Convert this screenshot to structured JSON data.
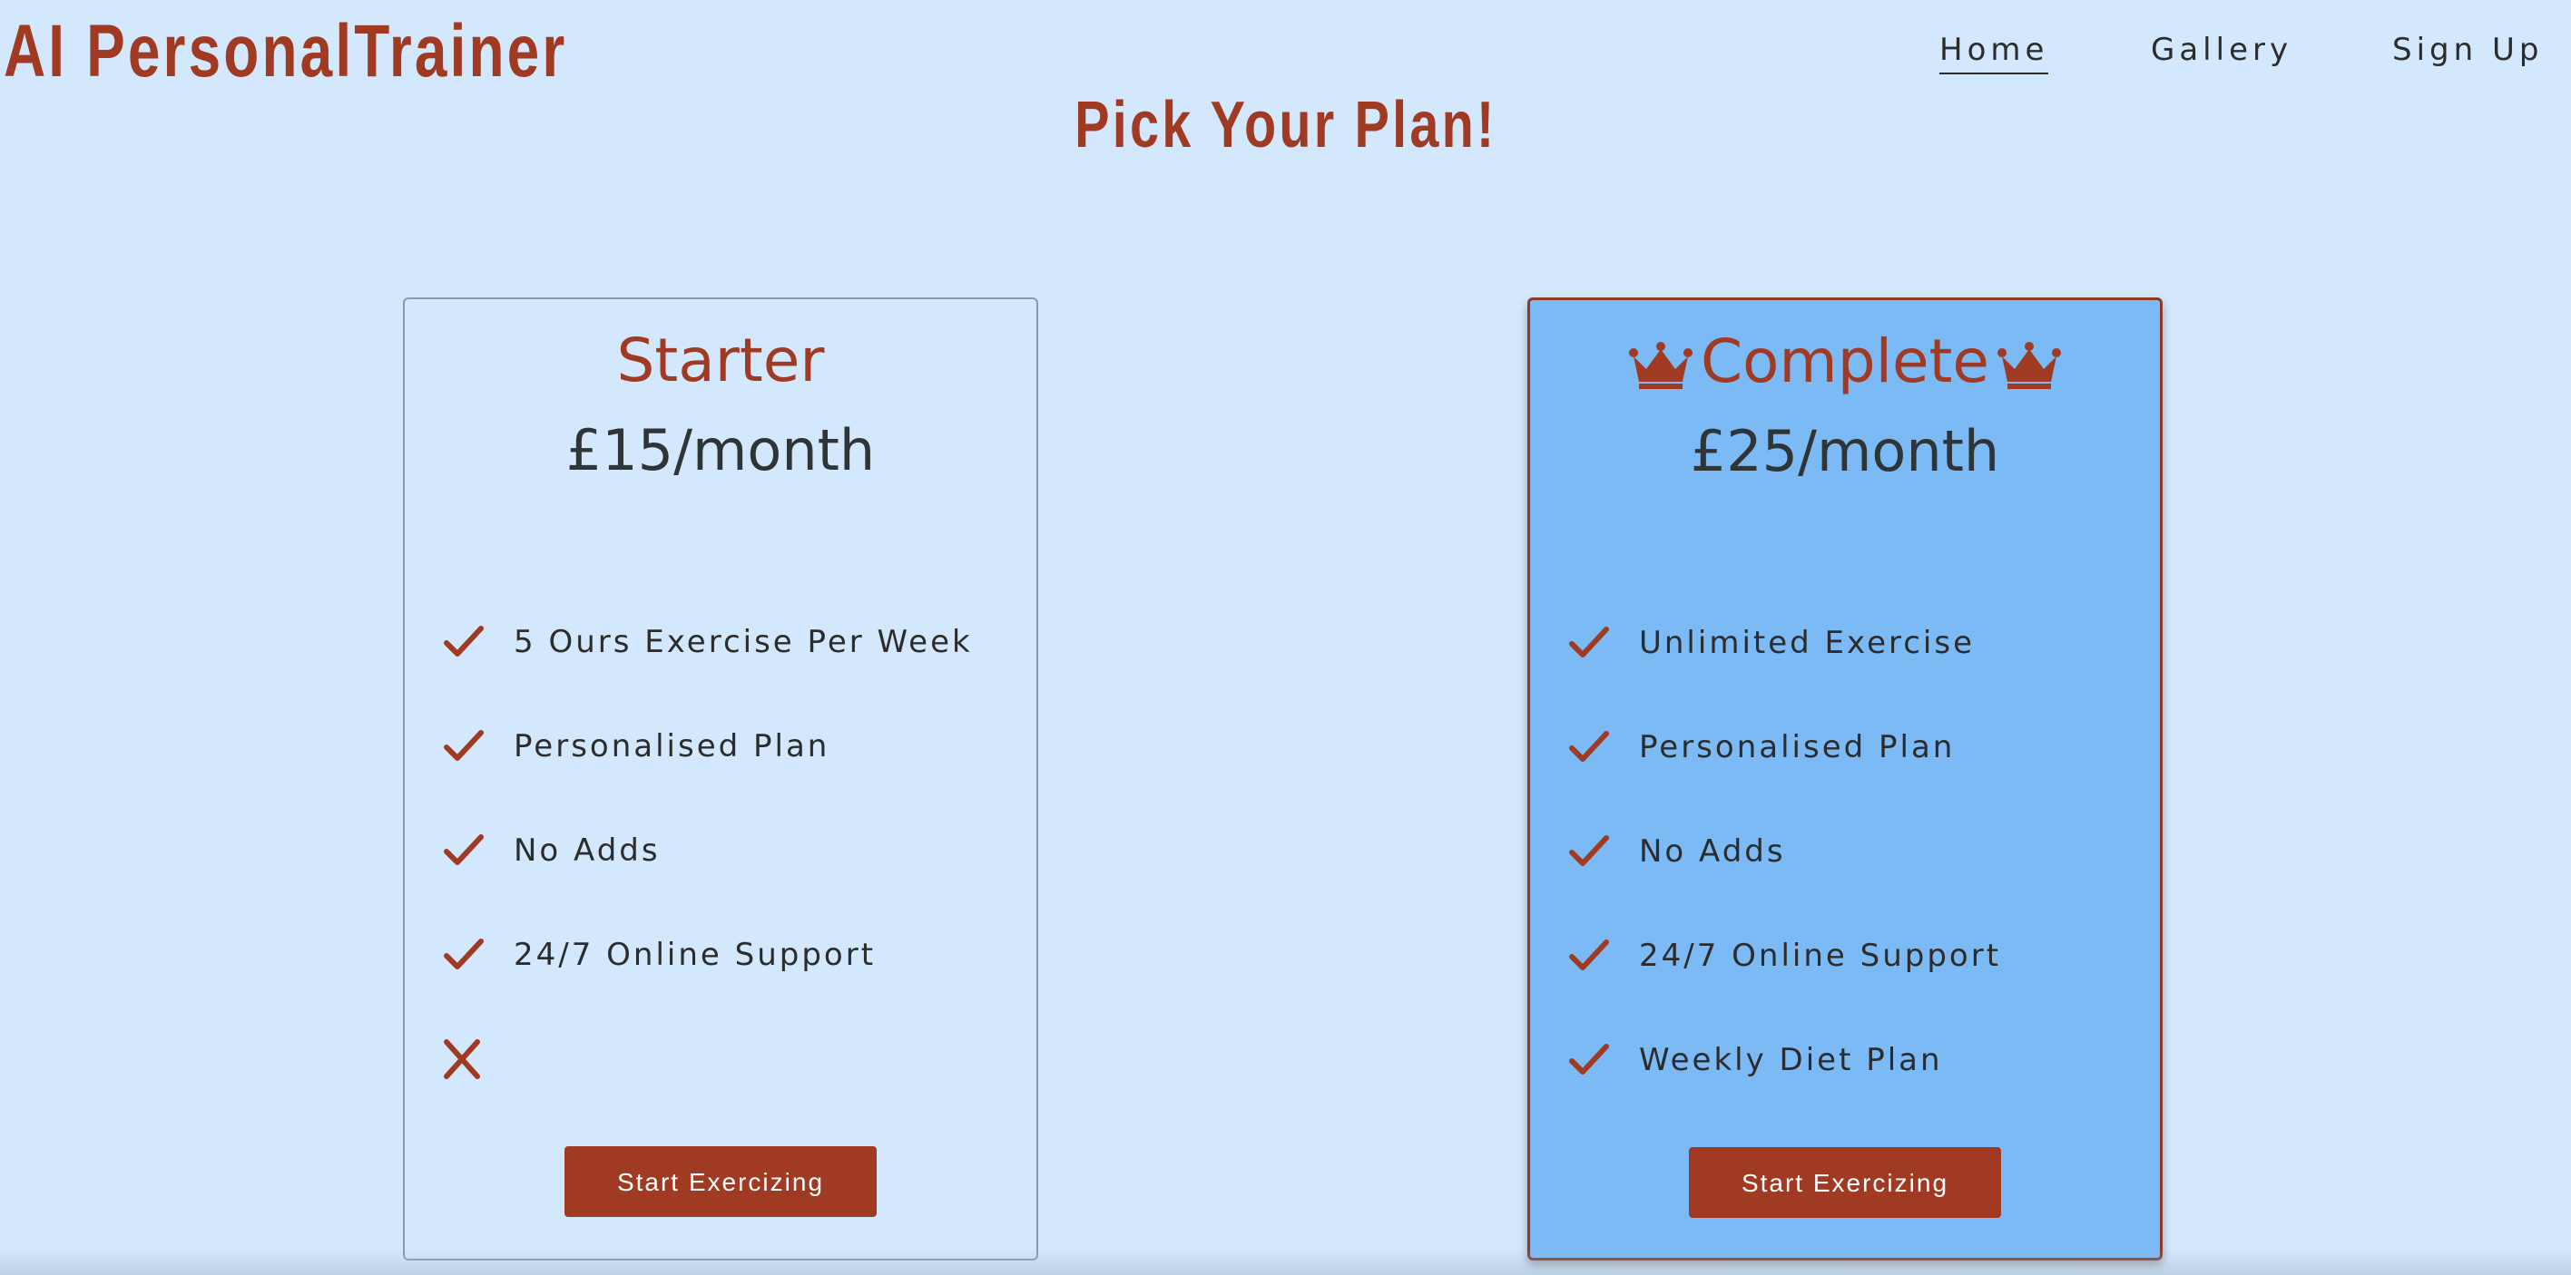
{
  "brand": "AI PersonalTrainer",
  "nav": {
    "home": "Home",
    "gallery": "Gallery",
    "signup": "Sign Up"
  },
  "headline": "Pick Your Plan!",
  "plans": [
    {
      "name": "Starter",
      "price": "£15/month",
      "features": [
        {
          "text": "5 Ours Exercise Per Week",
          "included": true
        },
        {
          "text": "Personalised Plan",
          "included": true
        },
        {
          "text": "No Adds",
          "included": true
        },
        {
          "text": "24/7 Online Support",
          "included": true
        },
        {
          "text": "",
          "included": false
        }
      ],
      "button": "Start Exercizing"
    },
    {
      "name": "Complete",
      "price": "£25/month",
      "icon": "crown-icon",
      "features": [
        {
          "text": "Unlimited Exercise",
          "included": true
        },
        {
          "text": "Personalised Plan",
          "included": true
        },
        {
          "text": "No Adds",
          "included": true
        },
        {
          "text": "24/7 Online Support",
          "included": true
        },
        {
          "text": "Weekly Diet Plan",
          "included": true
        }
      ],
      "button": "Start Exercizing"
    }
  ],
  "colors": {
    "background": "#d3e8fc",
    "accent": "#a03a22",
    "highlight_card": "#7cbaf6",
    "text": "#2c2c2c"
  }
}
